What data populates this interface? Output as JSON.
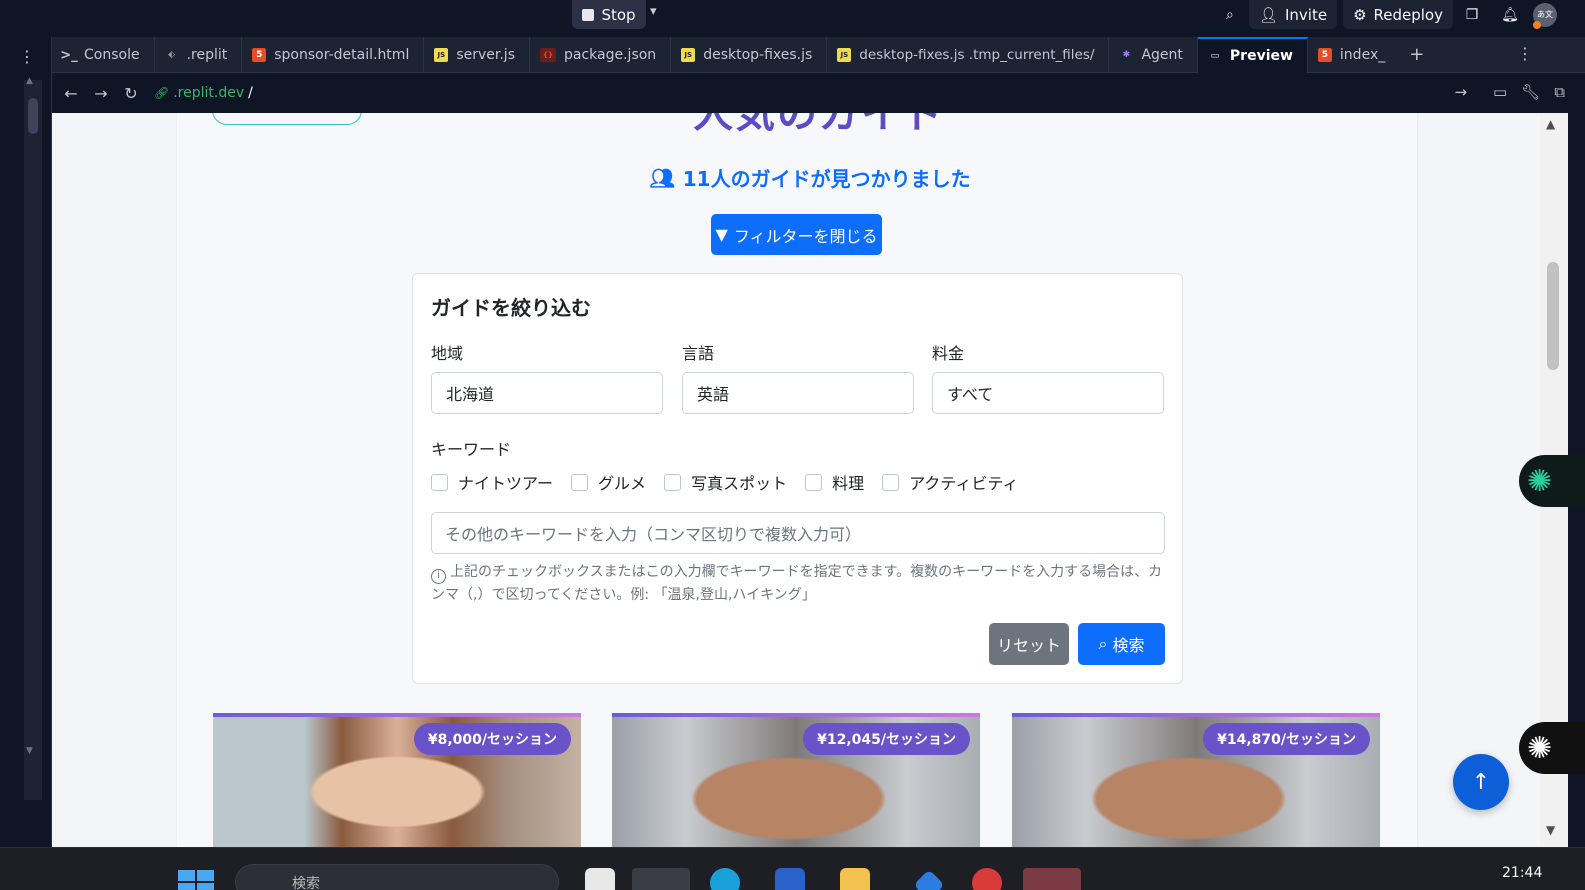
{
  "topbar": {
    "stop_label": "Stop",
    "invite_label": "Invite",
    "redeploy_label": "Redeploy",
    "avatar_text": "あ文"
  },
  "tabs": [
    {
      "label": "Console",
      "icon": "console-icon"
    },
    {
      "label": ".replit",
      "icon": "replit-file-icon"
    },
    {
      "label": "sponsor-detail.html",
      "icon": "html-file-icon"
    },
    {
      "label": "server.js",
      "icon": "js-file-icon"
    },
    {
      "label": "package.json",
      "icon": "json-file-icon"
    },
    {
      "label": "desktop-fixes.js",
      "icon": "js-file-icon"
    },
    {
      "label": "desktop-fixes.js .tmp_current_files/",
      "icon": "js-file-icon"
    },
    {
      "label": "Agent",
      "icon": "agent-icon"
    },
    {
      "label": "Preview",
      "icon": "preview-monitor-icon",
      "active": true
    },
    {
      "label": "index_",
      "icon": "html-file-icon"
    }
  ],
  "url": {
    "host": ".replit.dev",
    "path": "/"
  },
  "page": {
    "heading_fragment": "人気のガイド",
    "result_count": "11人のガイドが見つかりました",
    "filter_toggle_label": "フィルターを閉じる",
    "filter": {
      "title": "ガイドを絞り込む",
      "region_label": "地域",
      "region_value": "北海道",
      "language_label": "言語",
      "language_value": "英語",
      "price_label": "料金",
      "price_value": "すべて",
      "keyword_label": "キーワード",
      "keywords": [
        "ナイトツアー",
        "グルメ",
        "写真スポット",
        "料理",
        "アクティビティ"
      ],
      "keyword_placeholder": "その他のキーワードを入力（コンマ区切りで複数入力可）",
      "help_text": "上記のチェックボックスまたはこの入力欄でキーワードを指定できます。複数のキーワードを入力する場合は、カンマ（,）で区切ってください。例: 「温泉,登山,ハイキング」",
      "reset_label": "リセット",
      "search_label": "検索"
    },
    "guides": [
      {
        "price": "¥8,000/セッション"
      },
      {
        "price": "¥12,045/セッション"
      },
      {
        "price": "¥14,870/セッション"
      }
    ]
  },
  "taskbar": {
    "search_placeholder": "検索",
    "clock": "21:44"
  },
  "colors": {
    "primary": "#0d6efd",
    "reset": "#6c757d",
    "price_badge": "#6a52c9",
    "replit_bg": "#0e1525"
  }
}
